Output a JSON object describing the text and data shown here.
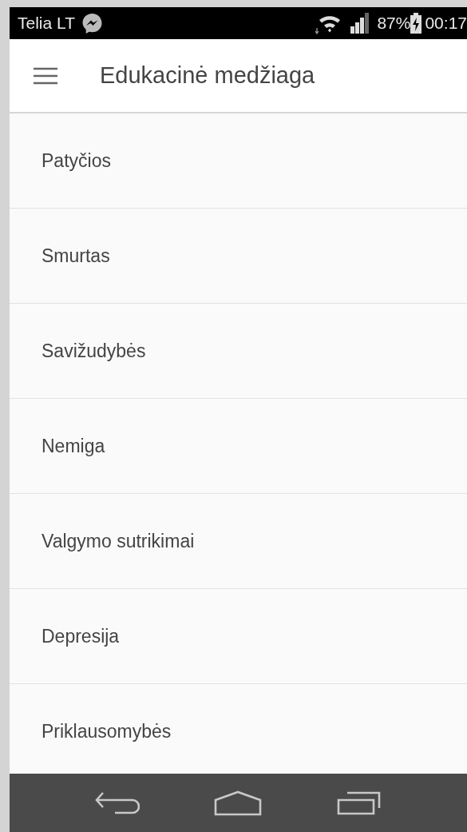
{
  "status_bar": {
    "carrier": "Telia LT",
    "battery": "87%",
    "time": "00:17"
  },
  "app_bar": {
    "title": "Edukacinė medžiaga"
  },
  "items": [
    {
      "label": "Patyčios"
    },
    {
      "label": "Smurtas"
    },
    {
      "label": "Savižudybės"
    },
    {
      "label": "Nemiga"
    },
    {
      "label": "Valgymo sutrikimai"
    },
    {
      "label": "Depresija"
    },
    {
      "label": "Priklausomybės"
    }
  ]
}
